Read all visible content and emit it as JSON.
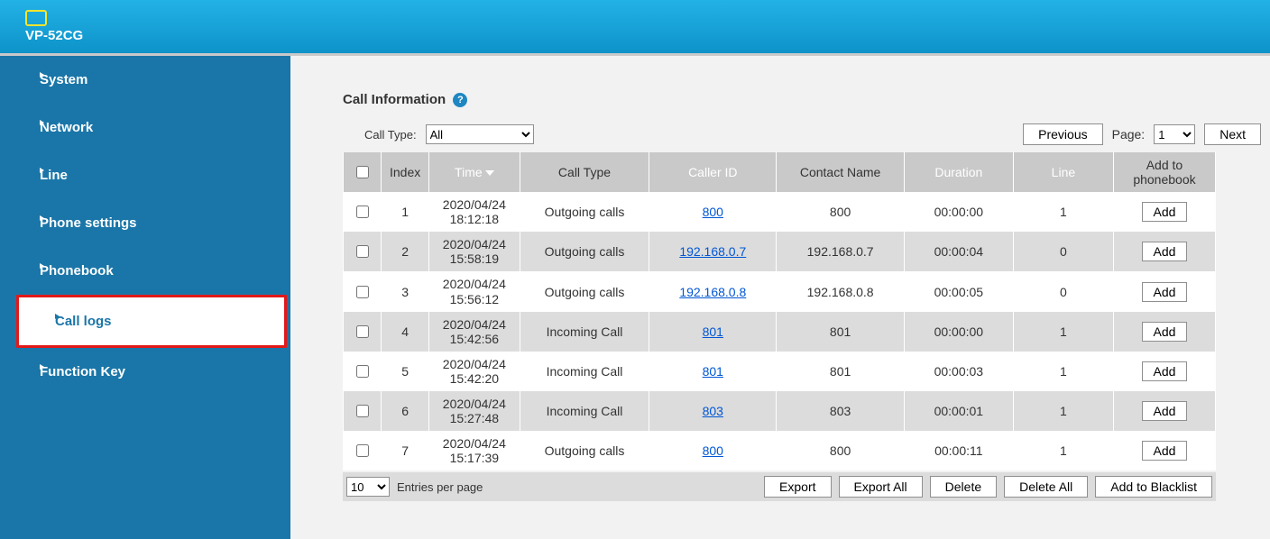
{
  "brand": "VP-52CG",
  "sidebar": {
    "items": [
      {
        "label": "System",
        "active": false
      },
      {
        "label": "Network",
        "active": false
      },
      {
        "label": "Line",
        "active": false
      },
      {
        "label": "Phone settings",
        "active": false
      },
      {
        "label": "Phonebook",
        "active": false
      },
      {
        "label": "Call logs",
        "active": true
      },
      {
        "label": "Function Key",
        "active": false
      }
    ]
  },
  "section": {
    "title": "Call Information",
    "filter_label": "Call Type:",
    "filter_value": "All",
    "btn_prev": "Previous",
    "page_label": "Page:",
    "page_value": "1",
    "btn_next": "Next"
  },
  "table": {
    "headers": {
      "index": "Index",
      "time": "Time",
      "type": "Call Type",
      "caller": "Caller ID",
      "contact": "Contact Name",
      "duration": "Duration",
      "line": "Line",
      "add": "Add to phonebook"
    },
    "rows": [
      {
        "index": "1",
        "time": "2020/04/24\n18:12:18",
        "type": "Outgoing calls",
        "caller": "800",
        "contact": "800",
        "duration": "00:00:00",
        "line": "1",
        "add": "Add"
      },
      {
        "index": "2",
        "time": "2020/04/24\n15:58:19",
        "type": "Outgoing calls",
        "caller": "192.168.0.7",
        "contact": "192.168.0.7",
        "duration": "00:00:04",
        "line": "0",
        "add": "Add"
      },
      {
        "index": "3",
        "time": "2020/04/24\n15:56:12",
        "type": "Outgoing calls",
        "caller": "192.168.0.8",
        "contact": "192.168.0.8",
        "duration": "00:00:05",
        "line": "0",
        "add": "Add"
      },
      {
        "index": "4",
        "time": "2020/04/24\n15:42:56",
        "type": "Incoming Call",
        "caller": "801",
        "contact": "801",
        "duration": "00:00:00",
        "line": "1",
        "add": "Add"
      },
      {
        "index": "5",
        "time": "2020/04/24\n15:42:20",
        "type": "Incoming Call",
        "caller": "801",
        "contact": "801",
        "duration": "00:00:03",
        "line": "1",
        "add": "Add"
      },
      {
        "index": "6",
        "time": "2020/04/24\n15:27:48",
        "type": "Incoming Call",
        "caller": "803",
        "contact": "803",
        "duration": "00:00:01",
        "line": "1",
        "add": "Add"
      },
      {
        "index": "7",
        "time": "2020/04/24\n15:17:39",
        "type": "Outgoing calls",
        "caller": "800",
        "contact": "800",
        "duration": "00:00:11",
        "line": "1",
        "add": "Add"
      }
    ]
  },
  "footer": {
    "per_page_value": "10",
    "per_page_label": "Entries per page",
    "btn_export": "Export",
    "btn_export_all": "Export All",
    "btn_delete": "Delete",
    "btn_delete_all": "Delete All",
    "btn_blacklist": "Add to Blacklist"
  }
}
